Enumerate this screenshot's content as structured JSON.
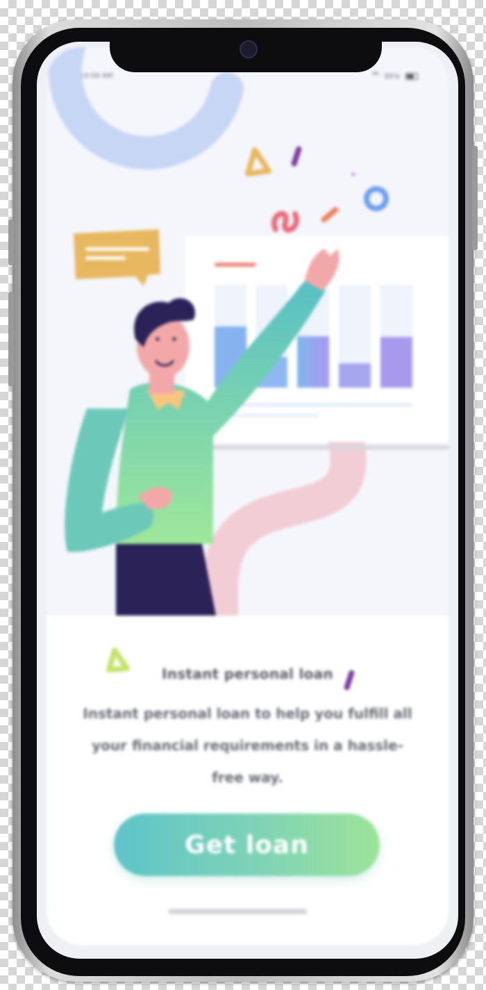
{
  "status_bar": {
    "time": "10:50 AM",
    "battery": "85%"
  },
  "onboarding": {
    "title": "Instant personal loan",
    "description": "Instant personal loan to help you fulfill all your financial requirements in a hassle-free way.",
    "cta_label": "Get loan"
  },
  "colors": {
    "accent_start": "#5ec4c9",
    "accent_end": "#9ee39a",
    "screen_background": "#f4f6fb"
  },
  "icons": [
    "wifi-icon",
    "battery-icon",
    "camera-icon"
  ]
}
